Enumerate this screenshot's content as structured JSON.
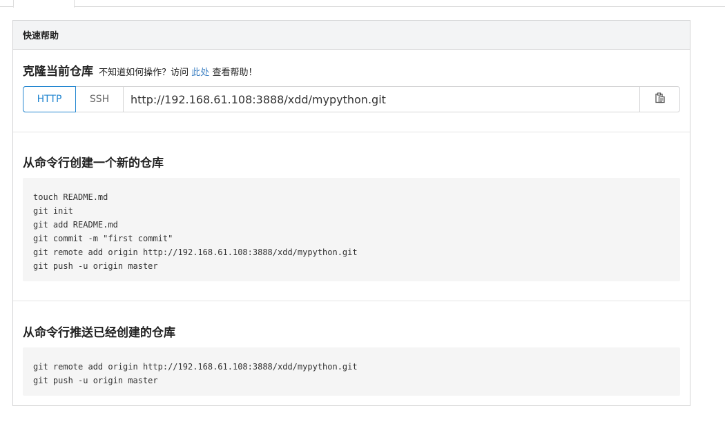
{
  "panel": {
    "header": "快速帮助"
  },
  "clone": {
    "title": "克隆当前仓库",
    "hint_before": "不知道如何操作？访问",
    "hint_link": "此处",
    "hint_after": "查看帮助！",
    "protocols": [
      "HTTP",
      "SSH"
    ],
    "active_protocol": "HTTP",
    "url": "http://192.168.61.108:3888/xdd/mypython.git",
    "copy_icon": "clipboard-icon"
  },
  "new_repo": {
    "title": "从命令行创建一个新的仓库",
    "lines": [
      "touch README.md",
      "git init",
      "git add README.md",
      "git commit -m \"first commit\"",
      "git remote add origin http://192.168.61.108:3888/xdd/mypython.git",
      "git push -u origin master"
    ]
  },
  "push_repo": {
    "title": "从命令行推送已经创建的仓库",
    "lines": [
      "git remote add origin http://192.168.61.108:3888/xdd/mypython.git",
      "git push -u origin master"
    ]
  },
  "colors": {
    "accent": "#2185d0",
    "link": "#4183c4",
    "code_bg": "#f5f5f5",
    "header_bg": "#f3f4f5"
  }
}
